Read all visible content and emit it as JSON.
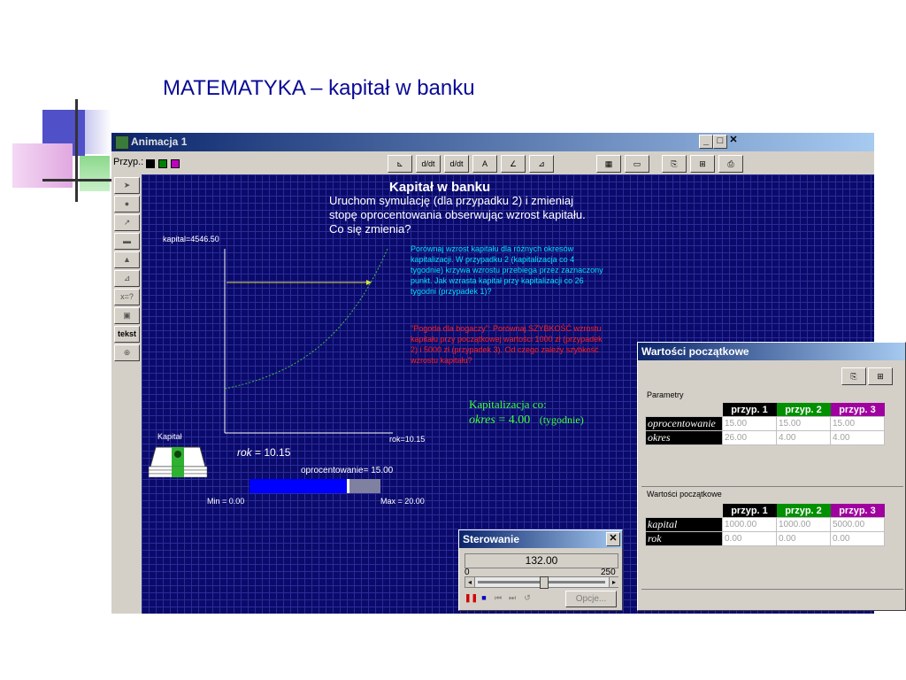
{
  "slide": {
    "title": "MATEMATYKA – kapitał w banku"
  },
  "app": {
    "title": "Animacja 1",
    "przyp_label": "Przyp.:",
    "leftbar_text_button": "tekst"
  },
  "canvas": {
    "heading": "Kapitał w banku",
    "instruction": "Uruchom symulację (dla przypadku 2) i zmieniaj stopę oprocentowania obserwując wzrost kapitału. Co się zmienia?",
    "cyan_note": "Porównaj wzrost kapitału dla różnych okresów kapitalizacji. W przypadku 2 (kapitalizacja co 4 tygodnie) krzywa wzrostu przebiega przez zaznaczony punkt. Jak wzrasta kapitał przy kapitalizacji co 26 tygodni (przypadek 1)?",
    "red_note": "\"Pogoda dla bogaczy\": Porównaj SZYBKOŚĆ wzrostu kapitału przy początkowej wartości 1000 zł (przypadek 2) i 5000 zł (przypadek 3). Od czego zależy szybkość wzrostu kapitału?",
    "y_axis_label": "kapital=4546.50",
    "x_axis_label": "rok=10.15",
    "kapital_label": "Kapitał",
    "rok_var": "rok",
    "rok_value": " = 10.15",
    "slider_label": "oprocentowanie= 15.00",
    "slider_min": "Min = 0.00",
    "slider_max": "Max = 20.00",
    "slider_fraction": 0.75,
    "kap_line1": "Kapitalizacja co:",
    "kap_var": "okres",
    "kap_value": " = 4.00",
    "kap_unit": "(tygodnie)"
  },
  "sterowanie": {
    "title": "Sterowanie",
    "time_value": "132.00",
    "range_min": "0",
    "range_max": "250",
    "opcje_label": "Opcje..."
  },
  "wartosci": {
    "title": "Wartości początkowe",
    "section1": "Parametry",
    "section2": "Wartości początkowe",
    "columns": [
      {
        "label": "przyp. 1",
        "color": "#000000"
      },
      {
        "label": "przyp. 2",
        "color": "#009000"
      },
      {
        "label": "przyp. 3",
        "color": "#a000a0"
      }
    ],
    "params": [
      {
        "name": "oprocentowanie",
        "values": [
          "15.00",
          "15.00",
          "15.00"
        ]
      },
      {
        "name": "okres",
        "values": [
          "26.00",
          "4.00",
          "4.00"
        ]
      }
    ],
    "initial": [
      {
        "name": "kapital",
        "values": [
          "1000.00",
          "1000.00",
          "5000.00"
        ]
      },
      {
        "name": "rok",
        "values": [
          "0.00",
          "0.00",
          "0.00"
        ]
      }
    ]
  }
}
